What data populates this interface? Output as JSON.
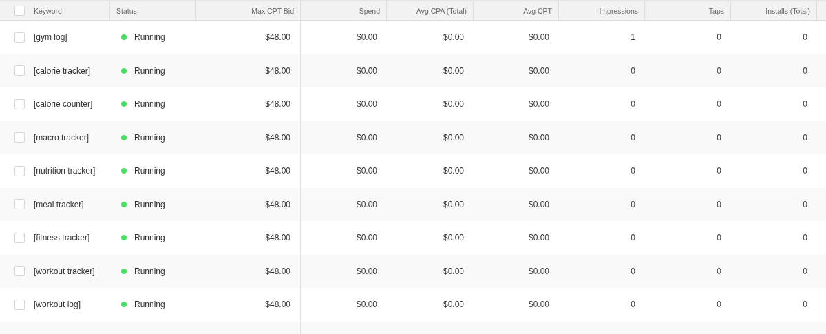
{
  "table": {
    "select_all_checked": false,
    "columns": [
      "Keyword",
      "Status",
      "Max CPT Bid",
      "Spend",
      "Avg CPA (Total)",
      "Avg CPT",
      "Impressions",
      "Taps",
      "Installs (Total)"
    ],
    "rows": [
      {
        "checked": false,
        "keyword": "[gym log]",
        "status": "Running",
        "color": "#4cd964",
        "max_cpt_bid": "$48.00",
        "spend": "$0.00",
        "avg_cpa": "$0.00",
        "avg_cpt": "$0.00",
        "impressions": "1",
        "taps": "0",
        "installs": "0"
      },
      {
        "checked": false,
        "keyword": "[calorie tracker]",
        "status": "Running",
        "color": "#4cd964",
        "max_cpt_bid": "$48.00",
        "spend": "$0.00",
        "avg_cpa": "$0.00",
        "avg_cpt": "$0.00",
        "impressions": "0",
        "taps": "0",
        "installs": "0"
      },
      {
        "checked": false,
        "keyword": "[calorie counter]",
        "status": "Running",
        "color": "#4cd964",
        "max_cpt_bid": "$48.00",
        "spend": "$0.00",
        "avg_cpa": "$0.00",
        "avg_cpt": "$0.00",
        "impressions": "0",
        "taps": "0",
        "installs": "0"
      },
      {
        "checked": false,
        "keyword": "[macro tracker]",
        "status": "Running",
        "color": "#4cd964",
        "max_cpt_bid": "$48.00",
        "spend": "$0.00",
        "avg_cpa": "$0.00",
        "avg_cpt": "$0.00",
        "impressions": "0",
        "taps": "0",
        "installs": "0"
      },
      {
        "checked": false,
        "keyword": "[nutrition tracker]",
        "status": "Running",
        "color": "#4cd964",
        "max_cpt_bid": "$48.00",
        "spend": "$0.00",
        "avg_cpa": "$0.00",
        "avg_cpt": "$0.00",
        "impressions": "0",
        "taps": "0",
        "installs": "0"
      },
      {
        "checked": false,
        "keyword": "[meal tracker]",
        "status": "Running",
        "color": "#4cd964",
        "max_cpt_bid": "$48.00",
        "spend": "$0.00",
        "avg_cpa": "$0.00",
        "avg_cpt": "$0.00",
        "impressions": "0",
        "taps": "0",
        "installs": "0"
      },
      {
        "checked": false,
        "keyword": "[fitness tracker]",
        "status": "Running",
        "color": "#4cd964",
        "max_cpt_bid": "$48.00",
        "spend": "$0.00",
        "avg_cpa": "$0.00",
        "avg_cpt": "$0.00",
        "impressions": "0",
        "taps": "0",
        "installs": "0"
      },
      {
        "checked": false,
        "keyword": "[workout tracker]",
        "status": "Running",
        "color": "#4cd964",
        "max_cpt_bid": "$48.00",
        "spend": "$0.00",
        "avg_cpa": "$0.00",
        "avg_cpt": "$0.00",
        "impressions": "0",
        "taps": "0",
        "installs": "0"
      },
      {
        "checked": false,
        "keyword": "[workout log]",
        "status": "Running",
        "color": "#4cd964",
        "max_cpt_bid": "$48.00",
        "spend": "$0.00",
        "avg_cpa": "$0.00",
        "avg_cpt": "$0.00",
        "impressions": "0",
        "taps": "0",
        "installs": "0"
      }
    ]
  }
}
